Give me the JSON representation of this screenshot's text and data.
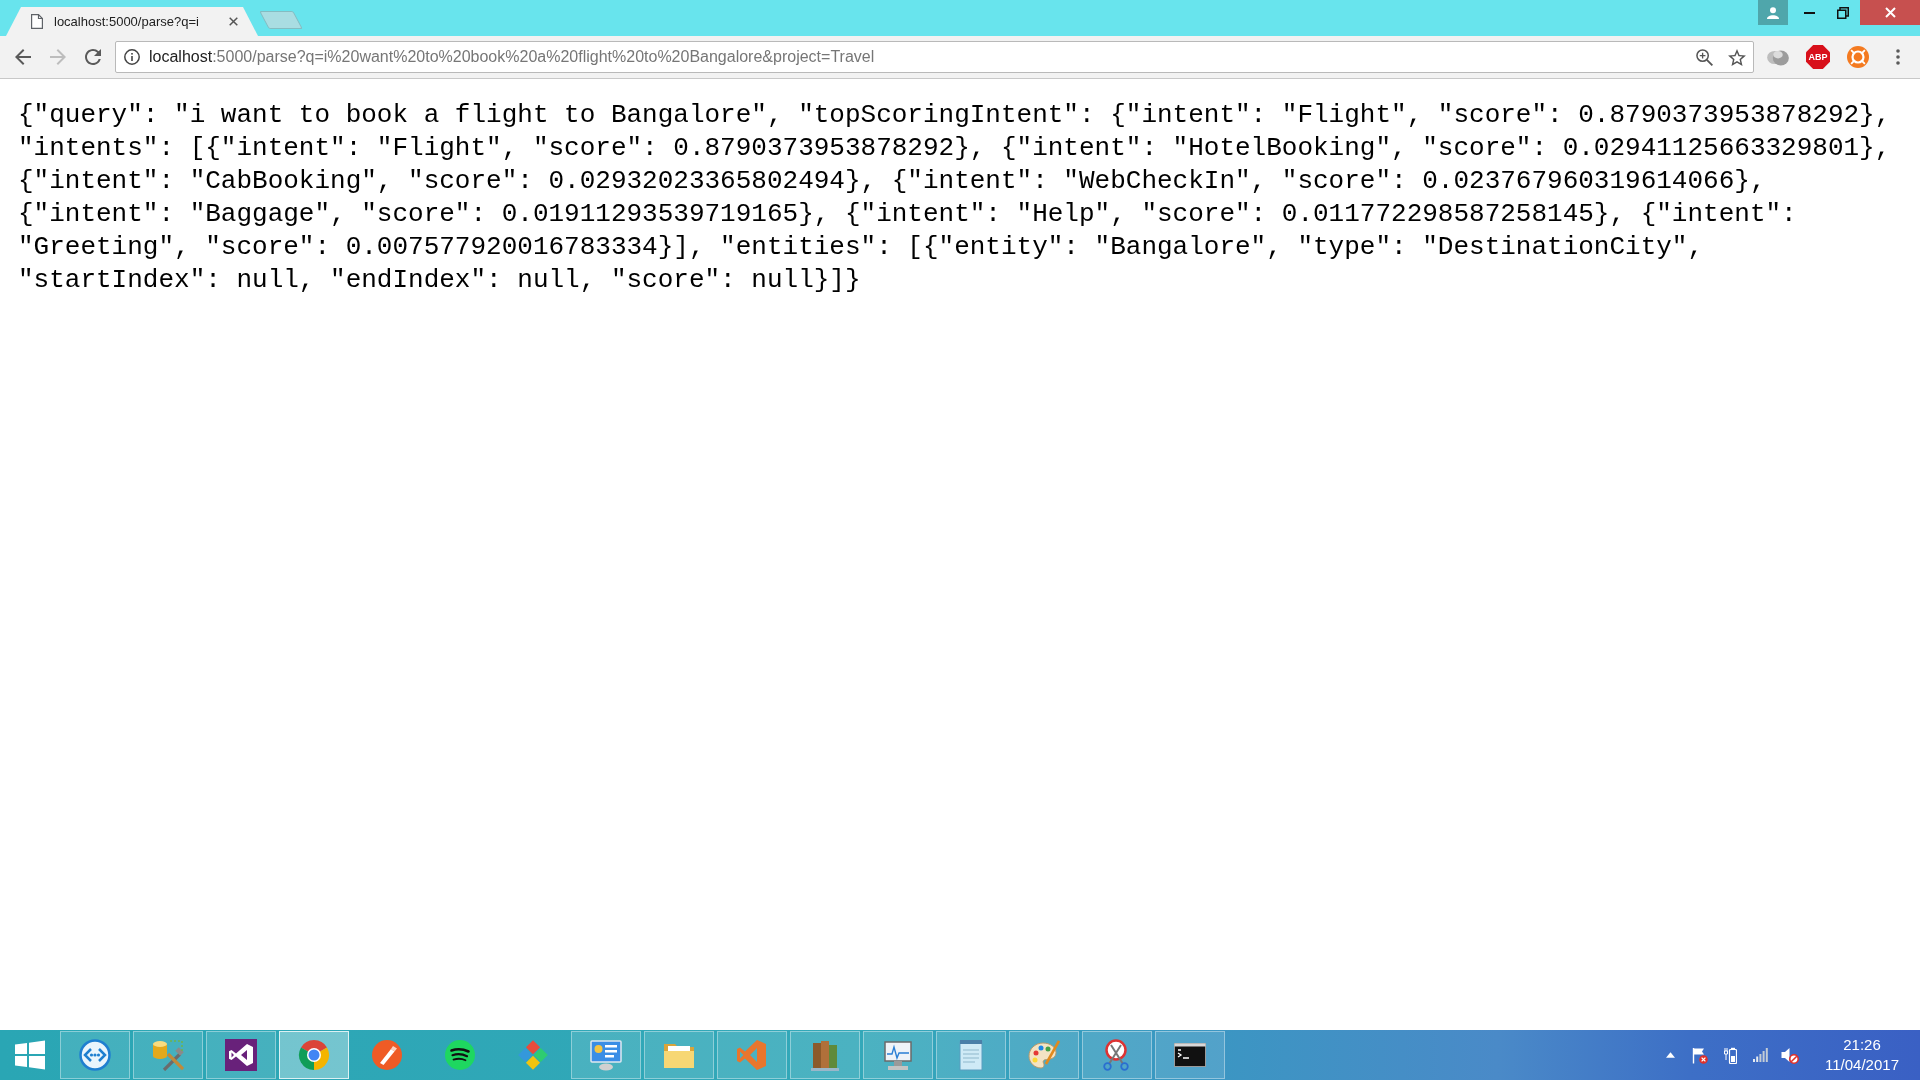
{
  "tabs": [
    {
      "title": "localhost:5000/parse?q=i",
      "selected": true
    }
  ],
  "toolbar": {
    "nav_buttons": [
      {
        "kind": "back",
        "disabled": false
      },
      {
        "kind": "forward",
        "disabled": true
      },
      {
        "kind": "reload",
        "disabled": false
      }
    ],
    "address_bar": {
      "host": "localhost",
      "path": ":5000/parse?q=i%20want%20to%20book%20a%20flight%20to%20Bangalore&project=Travel"
    },
    "extensions": [
      {
        "kind": "cloud"
      },
      {
        "kind": "octagon",
        "label": "ABP"
      },
      {
        "kind": "lifebuoy"
      }
    ]
  },
  "page": {
    "text": "{\"query\": \"i want to book a flight to Bangalore\", \"topScoringIntent\": {\"intent\": \"Flight\", \"score\": 0.8790373953878292}, \"intents\": [{\"intent\": \"Flight\", \"score\": 0.8790373953878292}, {\"intent\": \"HotelBooking\", \"score\": 0.02941125663329801}, {\"intent\": \"CabBooking\", \"score\": 0.02932023365802494}, {\"intent\": \"WebCheckIn\", \"score\": 0.023767960319614066}, {\"intent\": \"Baggage\", \"score\": 0.01911293539719165}, {\"intent\": \"Help\", \"score\": 0.011772298587258145}, {\"intent\": \"Greeting\", \"score\": 0.007577920016783334}], \"entities\": [{\"entity\": \"Bangalore\", \"type\": \"DestinationCity\", \"startIndex\": null, \"endIndex\": null, \"score\": null}]}"
  },
  "taskbar": {
    "apps": [
      {
        "kind": "circle-arrows",
        "running": true,
        "selected": false
      },
      {
        "kind": "database-tools",
        "running": true,
        "selected": false
      },
      {
        "kind": "ribbon-loop",
        "running": true,
        "selected": false
      },
      {
        "kind": "segmented-circle",
        "running": true,
        "selected": true
      },
      {
        "kind": "pen-circle",
        "running": false,
        "selected": false
      },
      {
        "kind": "waves-circle",
        "running": false,
        "selected": false
      },
      {
        "kind": "diamond-tiles",
        "running": false,
        "selected": false
      },
      {
        "kind": "monitor-panel",
        "running": true,
        "selected": false
      },
      {
        "kind": "folder",
        "running": true,
        "selected": false
      },
      {
        "kind": "angled-ribbon",
        "running": true,
        "selected": false
      },
      {
        "kind": "books",
        "running": true,
        "selected": false
      },
      {
        "kind": "monitor-graph",
        "running": true,
        "selected": false
      },
      {
        "kind": "notepad",
        "running": true,
        "selected": false
      },
      {
        "kind": "palette",
        "running": true,
        "selected": false
      },
      {
        "kind": "scissors",
        "running": true,
        "selected": false
      },
      {
        "kind": "terminal",
        "running": true,
        "selected": false
      }
    ],
    "tray": {
      "action_center_alert": true,
      "volume_muted": true
    },
    "clock": {
      "time": "21:26",
      "date": "11/04/2017"
    }
  }
}
